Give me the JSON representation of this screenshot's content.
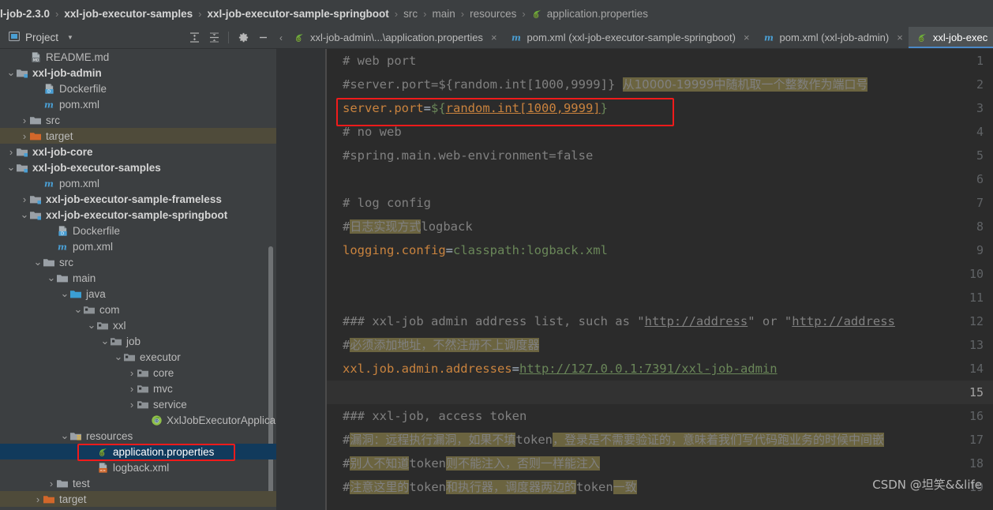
{
  "breadcrumb": {
    "name": "navigation-breadcrumb",
    "segments": [
      {
        "label": "l-job-2.3.0",
        "style": "bold",
        "icon": null
      },
      {
        "label": "xxl-job-executor-samples",
        "style": "bold",
        "icon": null
      },
      {
        "label": "xxl-job-executor-sample-springboot",
        "style": "bold",
        "icon": null
      },
      {
        "label": "src",
        "style": "dim",
        "icon": null
      },
      {
        "label": "main",
        "style": "dim",
        "icon": null
      },
      {
        "label": "resources",
        "style": "dim",
        "icon": null
      },
      {
        "label": "application.properties",
        "style": "dim",
        "icon": "spring-leaf-icon"
      }
    ],
    "separator": "›"
  },
  "project_panel": {
    "title": "Project",
    "title_icon": "project-window-icon",
    "dropdown_icon": "chevron-down-icon",
    "actions": [
      {
        "name": "expand-all-button",
        "icon": "expand-all-icon"
      },
      {
        "name": "collapse-all-button",
        "icon": "collapse-all-icon"
      },
      {
        "name": "settings-button",
        "icon": "gear-icon"
      },
      {
        "name": "hide-button",
        "icon": "minimize-icon"
      }
    ]
  },
  "tabs": {
    "collapse_icon": "chevron-left-icon",
    "items": [
      {
        "label": "xxl-job-admin\\...\\application.properties",
        "icon": "spring-leaf-icon",
        "active": false,
        "closable": true
      },
      {
        "label": "pom.xml (xxl-job-executor-sample-springboot)",
        "icon": "maven-m-icon",
        "active": false,
        "closable": true
      },
      {
        "label": "pom.xml (xxl-job-admin)",
        "icon": "maven-m-icon",
        "active": false,
        "closable": true
      },
      {
        "label": "xxl-job-exec",
        "icon": "spring-leaf-icon",
        "active": true,
        "closable": false
      }
    ]
  },
  "tree": {
    "rows": [
      {
        "label": "README.md",
        "indent": 2,
        "arrow": "",
        "icon": "markdown-file-icon",
        "bold": false,
        "state": "normal"
      },
      {
        "label": "xxl-job-admin",
        "indent": 1,
        "arrow": "down",
        "icon": "module-folder-icon",
        "bold": true,
        "state": "normal"
      },
      {
        "label": "Dockerfile",
        "indent": 3,
        "arrow": "",
        "icon": "docker-file-icon",
        "bold": false,
        "state": "normal"
      },
      {
        "label": "pom.xml",
        "indent": 3,
        "arrow": "",
        "icon": "maven-m-icon",
        "bold": false,
        "state": "normal"
      },
      {
        "label": "src",
        "indent": 2,
        "arrow": "right",
        "icon": "folder-icon",
        "bold": false,
        "state": "normal"
      },
      {
        "label": "target",
        "indent": 2,
        "arrow": "right",
        "icon": "orange-folder-icon",
        "bold": false,
        "state": "target"
      },
      {
        "label": "xxl-job-core",
        "indent": 1,
        "arrow": "right",
        "icon": "module-folder-icon",
        "bold": true,
        "state": "normal"
      },
      {
        "label": "xxl-job-executor-samples",
        "indent": 1,
        "arrow": "down",
        "icon": "module-folder-icon",
        "bold": true,
        "state": "normal"
      },
      {
        "label": "pom.xml",
        "indent": 3,
        "arrow": "",
        "icon": "maven-m-icon",
        "bold": false,
        "state": "normal"
      },
      {
        "label": "xxl-job-executor-sample-frameless",
        "indent": 2,
        "arrow": "right",
        "icon": "module-folder-icon",
        "bold": true,
        "state": "normal"
      },
      {
        "label": "xxl-job-executor-sample-springboot",
        "indent": 2,
        "arrow": "down",
        "icon": "module-folder-icon",
        "bold": true,
        "state": "normal"
      },
      {
        "label": "Dockerfile",
        "indent": 4,
        "arrow": "",
        "icon": "docker-file-icon",
        "bold": false,
        "state": "normal"
      },
      {
        "label": "pom.xml",
        "indent": 4,
        "arrow": "",
        "icon": "maven-m-icon",
        "bold": false,
        "state": "normal"
      },
      {
        "label": "src",
        "indent": 3,
        "arrow": "down",
        "icon": "folder-icon",
        "bold": false,
        "state": "normal"
      },
      {
        "label": "main",
        "indent": 4,
        "arrow": "down",
        "icon": "folder-icon",
        "bold": false,
        "state": "normal"
      },
      {
        "label": "java",
        "indent": 5,
        "arrow": "down",
        "icon": "source-folder-icon",
        "bold": false,
        "state": "normal"
      },
      {
        "label": "com",
        "indent": 6,
        "arrow": "down",
        "icon": "package-icon",
        "bold": false,
        "state": "normal"
      },
      {
        "label": "xxl",
        "indent": 7,
        "arrow": "down",
        "icon": "package-icon",
        "bold": false,
        "state": "normal"
      },
      {
        "label": "job",
        "indent": 8,
        "arrow": "down",
        "icon": "package-icon",
        "bold": false,
        "state": "normal"
      },
      {
        "label": "executor",
        "indent": 9,
        "arrow": "down",
        "icon": "package-icon",
        "bold": false,
        "state": "normal"
      },
      {
        "label": "core",
        "indent": 10,
        "arrow": "right",
        "icon": "package-icon",
        "bold": false,
        "state": "normal"
      },
      {
        "label": "mvc",
        "indent": 10,
        "arrow": "right",
        "icon": "package-icon",
        "bold": false,
        "state": "normal"
      },
      {
        "label": "service",
        "indent": 10,
        "arrow": "right",
        "icon": "package-icon",
        "bold": false,
        "state": "normal"
      },
      {
        "label": "XxlJobExecutorApplica",
        "indent": 11,
        "arrow": "",
        "icon": "spring-boot-class-icon",
        "bold": false,
        "state": "normal"
      },
      {
        "label": "resources",
        "indent": 5,
        "arrow": "down",
        "icon": "resources-folder-icon",
        "bold": false,
        "state": "normal"
      },
      {
        "label": "application.properties",
        "indent": 7,
        "arrow": "",
        "icon": "spring-leaf-icon",
        "bold": false,
        "state": "selected"
      },
      {
        "label": "logback.xml",
        "indent": 7,
        "arrow": "",
        "icon": "xml-file-icon",
        "bold": false,
        "state": "normal"
      },
      {
        "label": "test",
        "indent": 4,
        "arrow": "right",
        "icon": "folder-icon",
        "bold": false,
        "state": "normal"
      },
      {
        "label": "target",
        "indent": 3,
        "arrow": "right",
        "icon": "orange-folder-icon",
        "bold": false,
        "state": "target"
      }
    ]
  },
  "editor": {
    "file": "application.properties",
    "current_line": 15,
    "line_numbers": [
      1,
      2,
      3,
      4,
      5,
      6,
      7,
      8,
      9,
      10,
      11,
      12,
      13,
      14,
      15,
      16,
      17,
      18,
      19
    ],
    "lines": [
      {
        "n": 1,
        "parts": [
          {
            "t": "# web port",
            "c": "cm"
          }
        ]
      },
      {
        "n": 2,
        "parts": [
          {
            "t": "#server.port=${random.int[1000,9999]} ",
            "c": "cm"
          },
          {
            "t": "从10000-19999中随机取一个整数作为端口号",
            "c": "cm mark"
          }
        ]
      },
      {
        "n": 3,
        "parts": [
          {
            "t": "server.port",
            "c": "key"
          },
          {
            "t": "=",
            "c": "eq"
          },
          {
            "t": "${",
            "c": "val"
          },
          {
            "t": "random.int[1000,9999]",
            "c": "keyu"
          },
          {
            "t": "}",
            "c": "val"
          }
        ]
      },
      {
        "n": 4,
        "parts": [
          {
            "t": "# no web",
            "c": "cm"
          }
        ]
      },
      {
        "n": 5,
        "parts": [
          {
            "t": "#spring.main.web-environment=false",
            "c": "cm"
          }
        ]
      },
      {
        "n": 6,
        "parts": []
      },
      {
        "n": 7,
        "parts": [
          {
            "t": "# log config",
            "c": "cm"
          }
        ]
      },
      {
        "n": 8,
        "parts": [
          {
            "t": "#",
            "c": "cm"
          },
          {
            "t": "日志实现方式",
            "c": "cm mark"
          },
          {
            "t": "logback",
            "c": "cm"
          }
        ]
      },
      {
        "n": 9,
        "parts": [
          {
            "t": "logging.config",
            "c": "key"
          },
          {
            "t": "=",
            "c": "eq"
          },
          {
            "t": "classpath:logback.xml",
            "c": "val"
          }
        ]
      },
      {
        "n": 10,
        "parts": []
      },
      {
        "n": 11,
        "parts": []
      },
      {
        "n": 12,
        "parts": [
          {
            "t": "### xxl-job admin address list, such as \"",
            "c": "cm"
          },
          {
            "t": "http://address",
            "c": "cmu"
          },
          {
            "t": "\" or \"",
            "c": "cm"
          },
          {
            "t": "http://address",
            "c": "cmu"
          }
        ]
      },
      {
        "n": 13,
        "parts": [
          {
            "t": "#",
            "c": "cm"
          },
          {
            "t": "必须添加地址，不然注册不上调度器",
            "c": "cm mark"
          }
        ]
      },
      {
        "n": 14,
        "parts": [
          {
            "t": "xxl.job.admin.addresses",
            "c": "key"
          },
          {
            "t": "=",
            "c": "eq"
          },
          {
            "t": "http://127.0.0.1:7391/xxl-job-admin",
            "c": "valu"
          }
        ]
      },
      {
        "n": 15,
        "parts": []
      },
      {
        "n": 16,
        "parts": [
          {
            "t": "### xxl-job, access token",
            "c": "cm"
          }
        ]
      },
      {
        "n": 17,
        "parts": [
          {
            "t": "#",
            "c": "cm"
          },
          {
            "t": "漏洞：远程执行漏洞，如果不填",
            "c": "cm mark"
          },
          {
            "t": "token",
            "c": "cm"
          },
          {
            "t": "，登录是不需要验证的，意味着我们写代码跑业务的时候中间嵌",
            "c": "cm mark"
          }
        ]
      },
      {
        "n": 18,
        "parts": [
          {
            "t": "#",
            "c": "cm"
          },
          {
            "t": "别人不知道",
            "c": "cm mark"
          },
          {
            "t": "token",
            "c": "cm"
          },
          {
            "t": "则不能注入，否则一样能注入",
            "c": "cm mark"
          }
        ]
      },
      {
        "n": 19,
        "parts": [
          {
            "t": "#",
            "c": "cm"
          },
          {
            "t": "注意这里的",
            "c": "cm mark"
          },
          {
            "t": "token",
            "c": "cm"
          },
          {
            "t": "和执行器，调度器两边的",
            "c": "cm mark"
          },
          {
            "t": "token",
            "c": "cm"
          },
          {
            "t": "一致",
            "c": "cm mark"
          }
        ]
      }
    ]
  },
  "annotations": {
    "editor_highlight_box": {
      "name": "red-annotation-box-server-port"
    },
    "tree_highlight_box": {
      "name": "red-annotation-box-application-properties"
    },
    "accent_red": "#f01b1b",
    "accent_blue": "#4a88c7"
  },
  "watermark": {
    "text": "CSDN @坦笑&&life"
  }
}
